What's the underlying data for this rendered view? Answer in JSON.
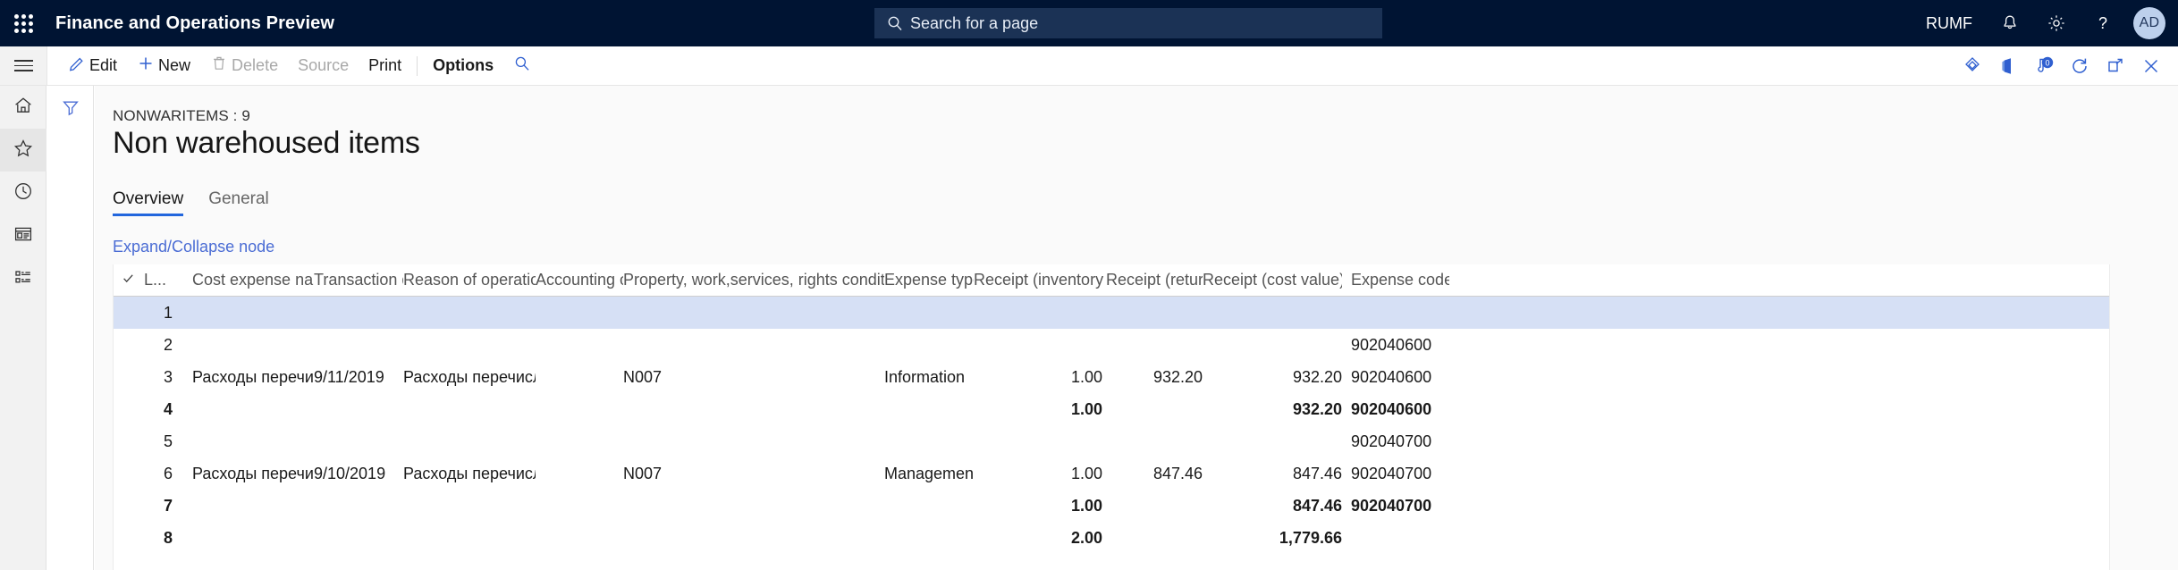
{
  "topbar": {
    "app_title": "Finance and Operations Preview",
    "waffle_icon": "app-launcher-icon",
    "search": {
      "placeholder": "Search for a page",
      "value": "",
      "icon": "search-icon"
    },
    "company": "RUMF",
    "icons": [
      "notification-bell-icon",
      "settings-gear-icon",
      "help-question-icon"
    ],
    "avatar_initials": "AD",
    "bg_color": "#001433",
    "search_bg_color": "#1b3255"
  },
  "commandbar": {
    "hamburger_icon": "hamburger-menu-icon",
    "buttons": [
      {
        "label": "Edit",
        "icon": "pencil-icon",
        "disabled": false,
        "bold": false
      },
      {
        "label": "New",
        "icon": "plus-icon",
        "disabled": false,
        "bold": false
      },
      {
        "label": "Delete",
        "icon": "trash-icon",
        "disabled": true,
        "bold": false
      },
      {
        "label": "Source",
        "icon": "",
        "disabled": true,
        "bold": false
      },
      {
        "label": "Print",
        "icon": "",
        "disabled": false,
        "bold": false
      },
      {
        "label": "Options",
        "icon": "",
        "disabled": false,
        "bold": true
      }
    ],
    "search_icon": "search-icon",
    "right_icons": [
      "attachments-icon",
      "office-open-icon",
      "notifications-count-icon",
      "refresh-icon",
      "popout-icon",
      "close-icon"
    ],
    "notification_count": "0",
    "accent_color": "#2f5fd0"
  },
  "rail": {
    "items": [
      {
        "icon": "home-icon",
        "active": false
      },
      {
        "icon": "favorites-star-icon",
        "active": true
      },
      {
        "icon": "recent-clock-icon",
        "active": false
      },
      {
        "icon": "workspaces-icon",
        "active": false
      },
      {
        "icon": "modules-list-icon",
        "active": false
      }
    ]
  },
  "filter_pane": {
    "icon": "filter-funnel-icon"
  },
  "page": {
    "breadcrumb": "NONWARITEMS : 9",
    "title": "Non warehoused items",
    "tabs": [
      {
        "label": "Overview",
        "active": true
      },
      {
        "label": "General",
        "active": false
      }
    ],
    "node_link": "Expand/Collapse node"
  },
  "grid": {
    "select_all_icon": "checkmark-icon",
    "columns": [
      "L...",
      "Cost expense name",
      "Transaction date",
      "Reason of operation",
      "Accounting obj...",
      "Property, work,services, rights conditions of receipt",
      "Expense type",
      "Receipt (inventory quantity)",
      "Receipt (return) unit price",
      "Receipt (cost value)",
      "Expense code"
    ],
    "selected_row_color": "#d6e0f5",
    "rows": [
      {
        "line": "1",
        "name": "",
        "date": "",
        "reason": "",
        "acct": "",
        "prop": "",
        "etype": "",
        "qty": "",
        "price": "",
        "cost": "",
        "code": "",
        "selected": true,
        "total": false
      },
      {
        "line": "2",
        "name": "",
        "date": "",
        "reason": "",
        "acct": "",
        "prop": "",
        "etype": "",
        "qty": "",
        "price": "",
        "cost": "",
        "code": "902040600",
        "selected": false,
        "total": false
      },
      {
        "line": "3",
        "name": "Расходы перечисление",
        "date": "9/11/2019",
        "reason": "Расходы перечисление",
        "acct": "",
        "prop": "N007",
        "etype": "Information",
        "qty": "1.00",
        "price": "932.20",
        "cost": "932.20",
        "code": "902040600",
        "selected": false,
        "total": false
      },
      {
        "line": "4",
        "name": "",
        "date": "",
        "reason": "",
        "acct": "",
        "prop": "",
        "etype": "",
        "qty": "1.00",
        "price": "",
        "cost": "932.20",
        "code": "902040600",
        "selected": false,
        "total": true
      },
      {
        "line": "5",
        "name": "",
        "date": "",
        "reason": "",
        "acct": "",
        "prop": "",
        "etype": "",
        "qty": "",
        "price": "",
        "cost": "",
        "code": "902040700",
        "selected": false,
        "total": false
      },
      {
        "line": "6",
        "name": "Расходы перечисление",
        "date": "9/10/2019",
        "reason": "Расходы перечисление",
        "acct": "",
        "prop": "N007",
        "etype": "Management",
        "qty": "1.00",
        "price": "847.46",
        "cost": "847.46",
        "code": "902040700",
        "selected": false,
        "total": false
      },
      {
        "line": "7",
        "name": "",
        "date": "",
        "reason": "",
        "acct": "",
        "prop": "",
        "etype": "",
        "qty": "1.00",
        "price": "",
        "cost": "847.46",
        "code": "902040700",
        "selected": false,
        "total": true
      },
      {
        "line": "8",
        "name": "",
        "date": "",
        "reason": "",
        "acct": "",
        "prop": "",
        "etype": "",
        "qty": "2.00",
        "price": "",
        "cost": "1,779.66",
        "code": "",
        "selected": false,
        "total": true
      }
    ]
  }
}
